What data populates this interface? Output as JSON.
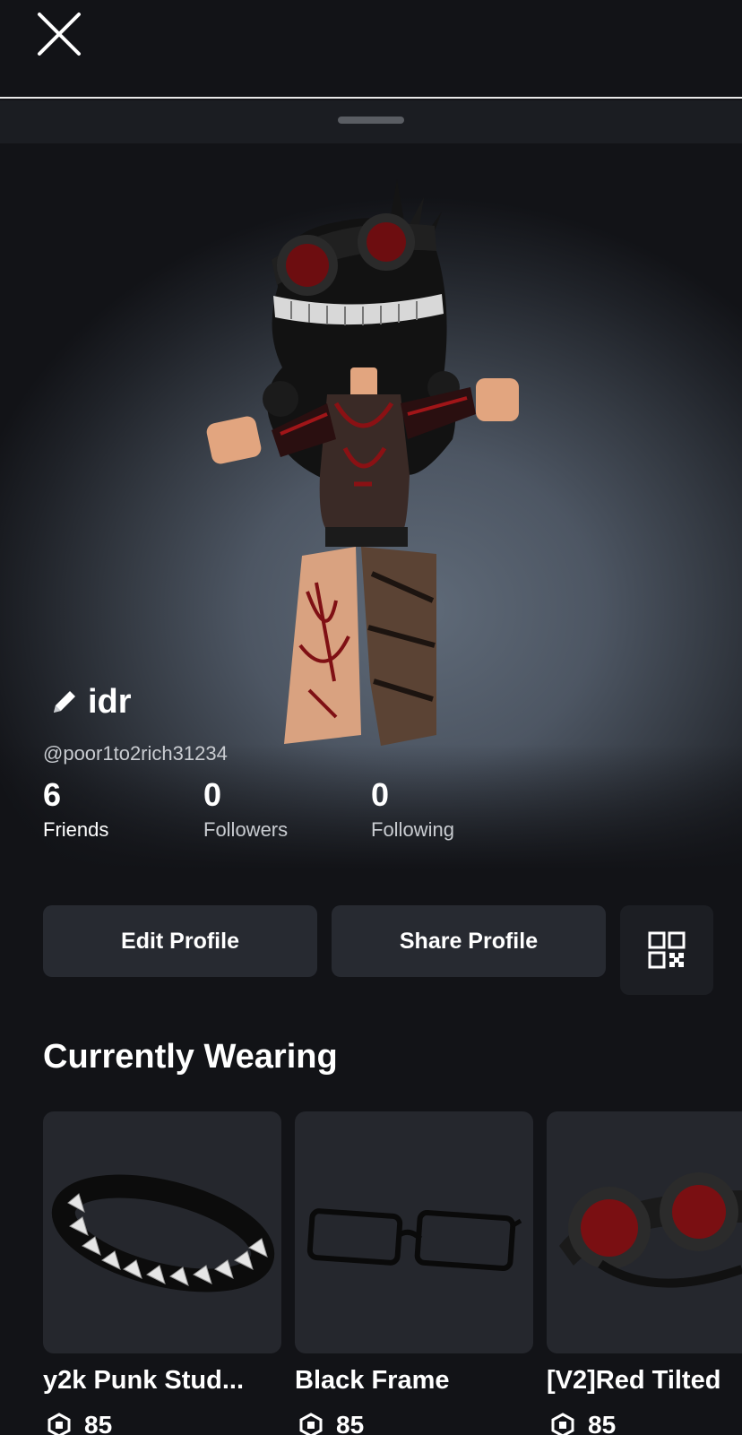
{
  "profile": {
    "display_name": "idr",
    "username": "@poor1to2rich31234"
  },
  "stats": [
    {
      "value": "6",
      "label": "Friends"
    },
    {
      "value": "0",
      "label": "Followers"
    },
    {
      "value": "0",
      "label": "Following"
    }
  ],
  "actions": {
    "edit_label": "Edit Profile",
    "share_label": "Share Profile"
  },
  "wearing": {
    "title": "Currently Wearing",
    "items": [
      {
        "name": "y2k Punk Stud...",
        "price": "85"
      },
      {
        "name": "Black Frame",
        "price": "85"
      },
      {
        "name": "[V2]Red Tilted",
        "price": "85"
      }
    ]
  },
  "icons": {
    "close": "close-icon",
    "edit": "pencil-icon",
    "qr": "qr-code-icon",
    "currency": "robux-icon"
  },
  "colors": {
    "background": "#121317",
    "button": "#272a31",
    "card": "#25272d",
    "secondary_text": "#c9ccd1"
  }
}
